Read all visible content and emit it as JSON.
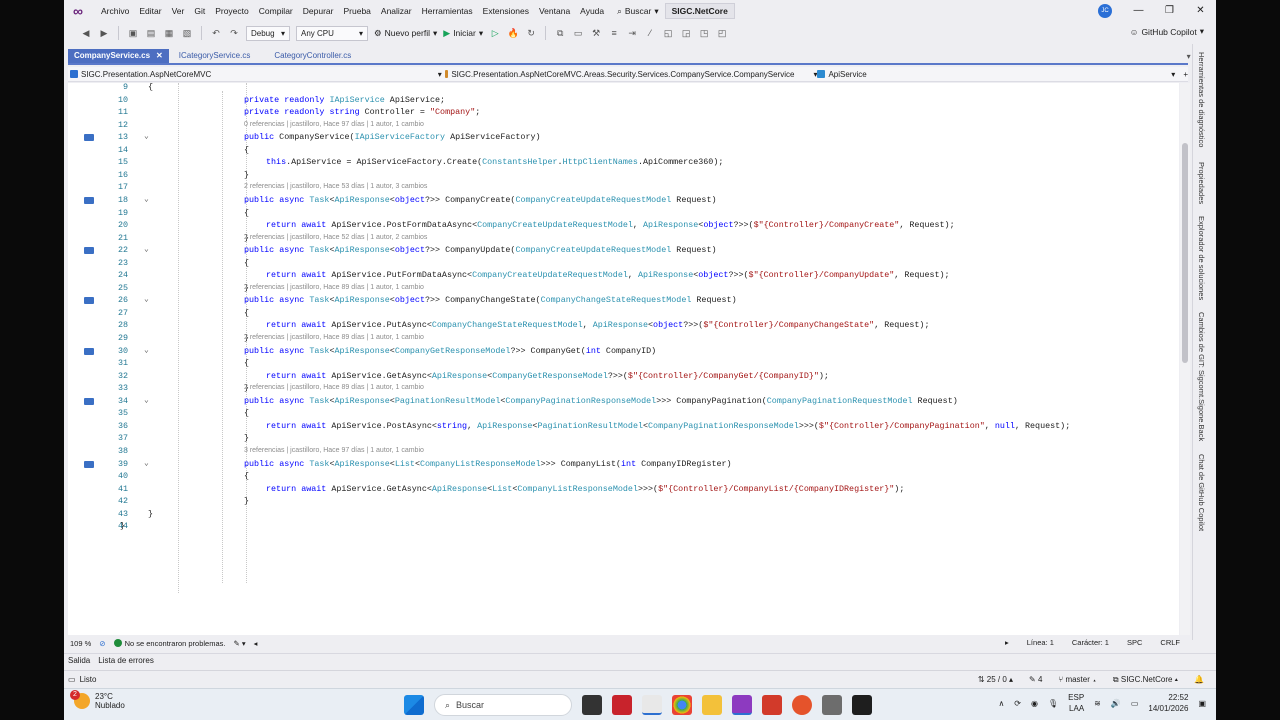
{
  "title_bar": {
    "menu": [
      "Archivo",
      "Editar",
      "Ver",
      "Git",
      "Proyecto",
      "Compilar",
      "Depurar",
      "Prueba",
      "Analizar",
      "Herramientas",
      "Extensiones",
      "Ventana",
      "Ayuda"
    ],
    "search_label": "Buscar",
    "solution_name": "SIGC.NetCore",
    "avatar_initials": "JC"
  },
  "toolbar": {
    "config": "Debug",
    "platform": "Any CPU",
    "profile": "Nuevo perfil",
    "start": "Iniciar",
    "copilot": "GitHub Copilot"
  },
  "tabs": [
    {
      "label": "CompanyService.cs",
      "active": true
    },
    {
      "label": "ICategoryService.cs",
      "active": false
    },
    {
      "label": "CategoryController.cs",
      "active": false
    }
  ],
  "navbar": {
    "project": "SIGC.Presentation.AspNetCoreMVC",
    "type": "SIGC.Presentation.AspNetCoreMVC.Areas.Security.Services.CompanyService.CompanyService",
    "member": "ApiService"
  },
  "code_lines": [
    {
      "n": "9",
      "text": "{"
    },
    {
      "n": "10",
      "text": "private readonly IApiService ApiService;"
    },
    {
      "n": "11",
      "text": "private readonly string Controller = \"Company\";"
    },
    {
      "n": "12",
      "text": ""
    },
    {
      "n": "13",
      "text": "public CompanyService(IApiServiceFactory ApiServiceFactory)",
      "lens": "0 referencias | jcastilloro, Hace 97 días | 1 autor, 1 cambio"
    },
    {
      "n": "14",
      "text": "{"
    },
    {
      "n": "15",
      "text": "this.ApiService = ApiServiceFactory.Create(ConstantsHelper.HttpClientNames.ApiCommerce360);"
    },
    {
      "n": "16",
      "text": "}"
    },
    {
      "n": "17",
      "text": ""
    },
    {
      "n": "18",
      "text": "public async Task<ApiResponse<object?>> CompanyCreate(CompanyCreateUpdateRequestModel Request)",
      "lens": "2 referencias | jcastilloro, Hace 53 días | 1 autor, 3 cambios"
    },
    {
      "n": "19",
      "text": "{"
    },
    {
      "n": "20",
      "text": "return await ApiService.PostFormDataAsync<CompanyCreateUpdateRequestModel, ApiResponse<object?>>($\"{Controller}/CompanyCreate\", Request);"
    },
    {
      "n": "21",
      "text": "}"
    },
    {
      "n": "22",
      "text": "public async Task<ApiResponse<object?>> CompanyUpdate(CompanyCreateUpdateRequestModel Request)",
      "lens": "2 referencias | jcastilloro, Hace 52 días | 1 autor, 2 cambios"
    },
    {
      "n": "23",
      "text": "{"
    },
    {
      "n": "24",
      "text": "return await ApiService.PutFormDataAsync<CompanyCreateUpdateRequestModel, ApiResponse<object?>>($\"{Controller}/CompanyUpdate\", Request);"
    },
    {
      "n": "25",
      "text": "}"
    },
    {
      "n": "26",
      "text": "public async Task<ApiResponse<object?>> CompanyChangeState(CompanyChangeStateRequestModel Request)",
      "lens": "2 referencias | jcastilloro, Hace 89 días | 1 autor, 1 cambio"
    },
    {
      "n": "27",
      "text": "{"
    },
    {
      "n": "28",
      "text": "return await ApiService.PutAsync<CompanyChangeStateRequestModel, ApiResponse<object?>>($\"{Controller}/CompanyChangeState\", Request);"
    },
    {
      "n": "29",
      "text": "}"
    },
    {
      "n": "30",
      "text": "public async Task<ApiResponse<CompanyGetResponseModel?>> CompanyGet(int CompanyID)",
      "lens": "2 referencias | jcastilloro, Hace 89 días | 1 autor, 1 cambio"
    },
    {
      "n": "31",
      "text": "{"
    },
    {
      "n": "32",
      "text": "return await ApiService.GetAsync<ApiResponse<CompanyGetResponseModel?>>($\"{Controller}/CompanyGet/{CompanyID}\");"
    },
    {
      "n": "33",
      "text": "}"
    },
    {
      "n": "34",
      "text": "public async Task<ApiResponse<PaginationResultModel<CompanyPaginationResponseModel>>> CompanyPagination(CompanyPaginationRequestModel Request)",
      "lens": "2 referencias | jcastilloro, Hace 89 días | 1 autor, 1 cambio"
    },
    {
      "n": "35",
      "text": "{"
    },
    {
      "n": "36",
      "text": "return await ApiService.PostAsync<string, ApiResponse<PaginationResultModel<CompanyPaginationResponseModel>>>($\"{Controller}/CompanyPagination\", null, Request);"
    },
    {
      "n": "37",
      "text": "}"
    },
    {
      "n": "38",
      "text": ""
    },
    {
      "n": "39",
      "text": "public async Task<ApiResponse<List<CompanyListResponseModel>>> CompanyList(int CompanyIDRegister)",
      "lens": "3 referencias | jcastilloro, Hace 97 días | 1 autor, 1 cambio"
    },
    {
      "n": "40",
      "text": "{"
    },
    {
      "n": "41",
      "text": "return await ApiService.GetAsync<ApiResponse<List<CompanyListResponseModel>>>($\"{Controller}/CompanyList/{CompanyIDRegister}\");"
    },
    {
      "n": "42",
      "text": "}"
    },
    {
      "n": "43",
      "text": "}"
    },
    {
      "n": "44",
      "text": "}"
    }
  ],
  "side_panel": [
    "Herramientas de diagnóstico",
    "Propiedades",
    "Explorador de soluciones",
    "Cambios de GIT: Sigcomt.Sigone.Back",
    "Chat de GitHub Copilot"
  ],
  "editor_status": {
    "zoom": "109 %",
    "problems": "No se encontraron problemas.",
    "line": "Línea: 1",
    "char": "Carácter: 1",
    "spc": "SPC",
    "crlf": "CRLF"
  },
  "output_tabs": [
    "Salida",
    "Lista de errores"
  ],
  "status_bar": {
    "ready": "Listo",
    "changes": "25 / 0",
    "edits": "4",
    "branch": "master",
    "repo": "SIGC.NetCore"
  },
  "taskbar": {
    "temp": "23°C",
    "weather": "Nublado",
    "weather_badge": "2",
    "search": "Buscar",
    "lang1": "ESP",
    "lang2": "LAA",
    "time": "22:52",
    "date": "14/01/2026"
  },
  "colors": {
    "keyword": "#0000ff",
    "type": "#2b91af",
    "string": "#a31515",
    "accent": "#4d6ec1"
  }
}
